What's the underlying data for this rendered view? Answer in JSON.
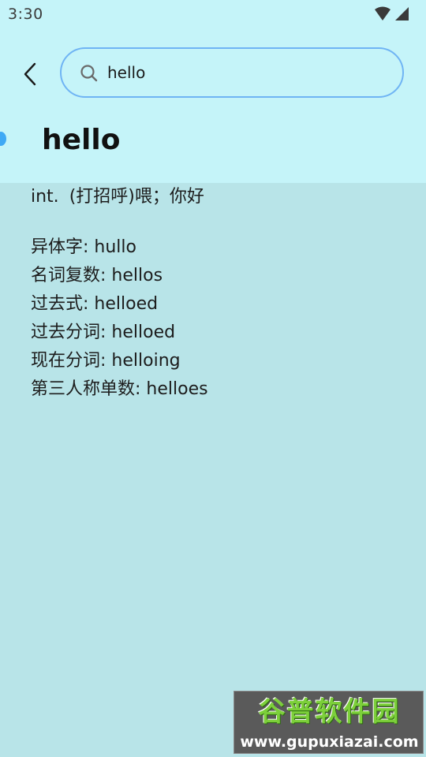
{
  "status_bar": {
    "time": "3:30",
    "icons": [
      "wifi-icon",
      "signal-icon"
    ]
  },
  "search": {
    "value": "hello",
    "icon": "search-icon"
  },
  "entry": {
    "word": "hello",
    "definition": {
      "pos": "int.",
      "meaning": "(打招呼)喂；你好"
    },
    "forms": [
      {
        "label": "异体字:",
        "value": "hullo"
      },
      {
        "label": "名词复数:",
        "value": "hellos"
      },
      {
        "label": "过去式:",
        "value": "helloed"
      },
      {
        "label": "过去分词:",
        "value": "helloed"
      },
      {
        "label": "现在分词:",
        "value": "helloing"
      },
      {
        "label": "第三人称单数:",
        "value": "helloes"
      }
    ]
  },
  "watermark": {
    "title": "谷普软件园",
    "url": "www.gupuxiazai.com"
  },
  "colors": {
    "header_bg": "#c5f4f9",
    "body_bg": "#b8e4e8",
    "search_border": "#6fb4f4",
    "accent": "#3fa9f5"
  }
}
